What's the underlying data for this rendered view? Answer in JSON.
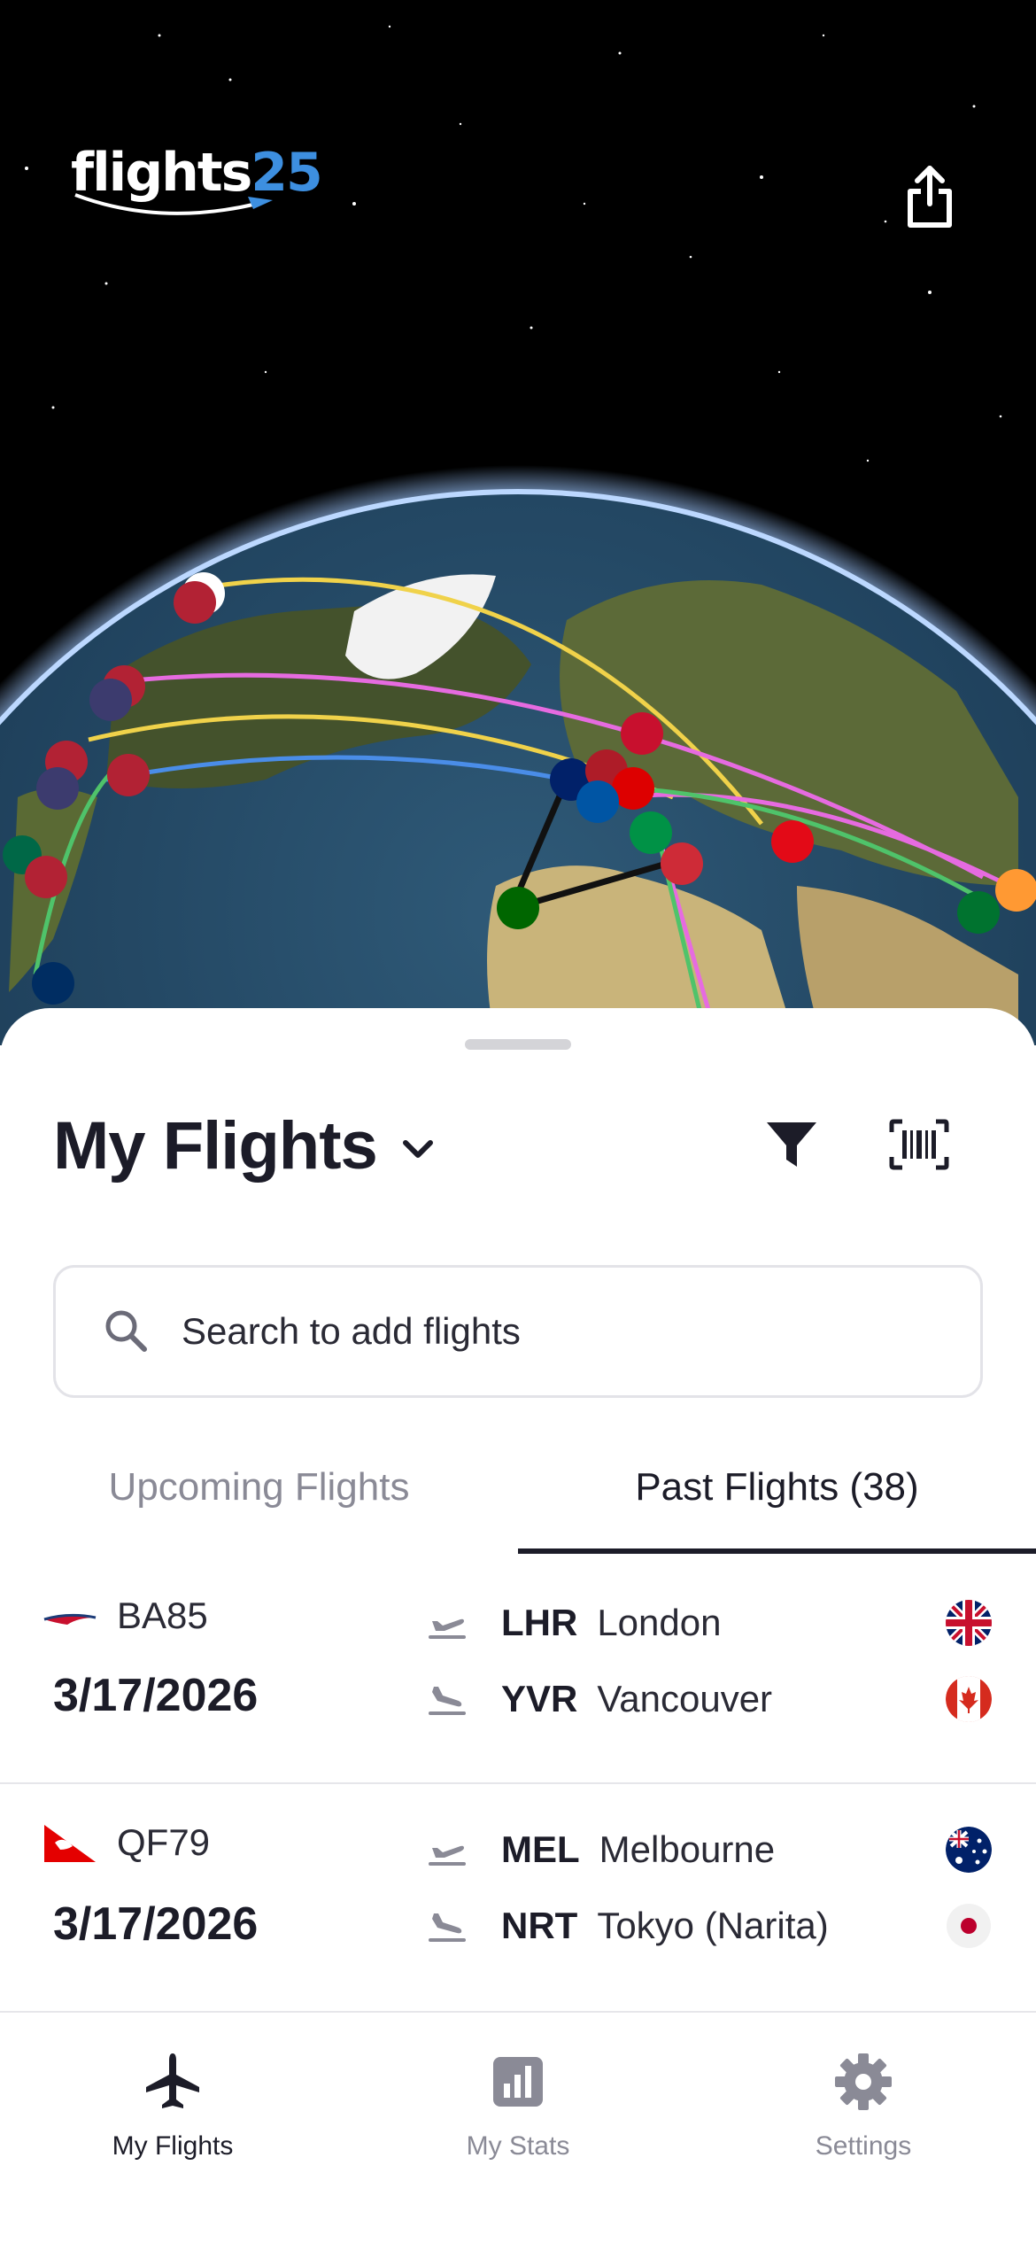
{
  "app": {
    "logo_text": "flights",
    "logo_number": "25"
  },
  "sheet": {
    "title": "My Flights"
  },
  "search": {
    "placeholder": "Search to add flights"
  },
  "tabs": [
    {
      "label": "Upcoming Flights",
      "active": false
    },
    {
      "label": "Past Flights (38)",
      "active": true
    }
  ],
  "flights": [
    {
      "airline": "British Airways",
      "flight_number": "BA85",
      "date": "3/17/2026",
      "departure": {
        "code": "LHR",
        "city": "London",
        "flag": "uk"
      },
      "arrival": {
        "code": "YVR",
        "city": "Vancouver",
        "flag": "canada"
      }
    },
    {
      "airline": "Qantas",
      "flight_number": "QF79",
      "date": "3/17/2026",
      "departure": {
        "code": "MEL",
        "city": "Melbourne",
        "flag": "australia"
      },
      "arrival": {
        "code": "NRT",
        "city": "Tokyo (Narita)",
        "flag": "japan"
      }
    }
  ],
  "navigation": [
    {
      "label": "My Flights",
      "icon": "airplane-icon",
      "active": true
    },
    {
      "label": "My Stats",
      "icon": "stats-icon",
      "active": false
    },
    {
      "label": "Settings",
      "icon": "gear-icon",
      "active": false
    }
  ],
  "colors": {
    "accent": "#3d8fe0",
    "text": "#1c1c28",
    "muted": "#8a8a96"
  }
}
